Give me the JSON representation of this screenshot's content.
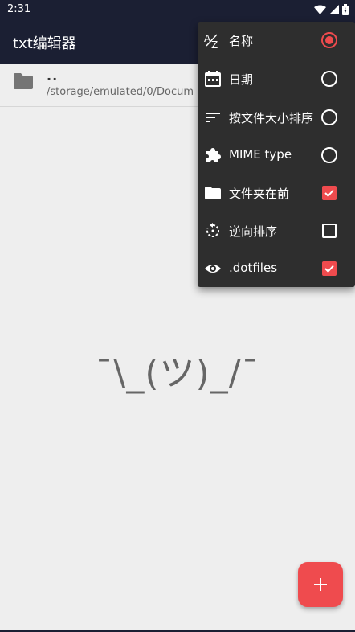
{
  "status_bar": {
    "time": "2:31",
    "icons": [
      "wifi-icon",
      "signal-icon",
      "battery-icon"
    ]
  },
  "app_bar": {
    "title": "txt编辑器"
  },
  "file_list": {
    "parent": {
      "name": "..",
      "path": "/storage/emulated/0/Docum",
      "icon": "folder-icon"
    }
  },
  "empty_state": {
    "text": "¯\\_(ツ)_/¯"
  },
  "fab": {
    "icon": "plus-icon"
  },
  "sort_menu": {
    "items": [
      {
        "label": "名称",
        "icon": "sort-az-icon",
        "control": "radio",
        "checked": true
      },
      {
        "label": "日期",
        "icon": "calendar-icon",
        "control": "radio",
        "checked": false
      },
      {
        "label": "按文件大小排序",
        "icon": "sort-lines-icon",
        "control": "radio",
        "checked": false
      },
      {
        "label": "MIME type",
        "icon": "puzzle-icon",
        "control": "radio",
        "checked": false
      },
      {
        "label": "文件夹在前",
        "icon": "folder-icon",
        "control": "checkbox",
        "checked": true
      },
      {
        "label": "逆向排序",
        "icon": "reverse-icon",
        "control": "checkbox",
        "checked": false
      },
      {
        "label": ".dotfiles",
        "icon": "eye-icon",
        "control": "checkbox",
        "checked": true
      }
    ]
  },
  "colors": {
    "appbar": "#1b1f33",
    "accent": "#ef4b4e",
    "menu_bg": "#2e2e2e",
    "background": "#eeeeee"
  }
}
